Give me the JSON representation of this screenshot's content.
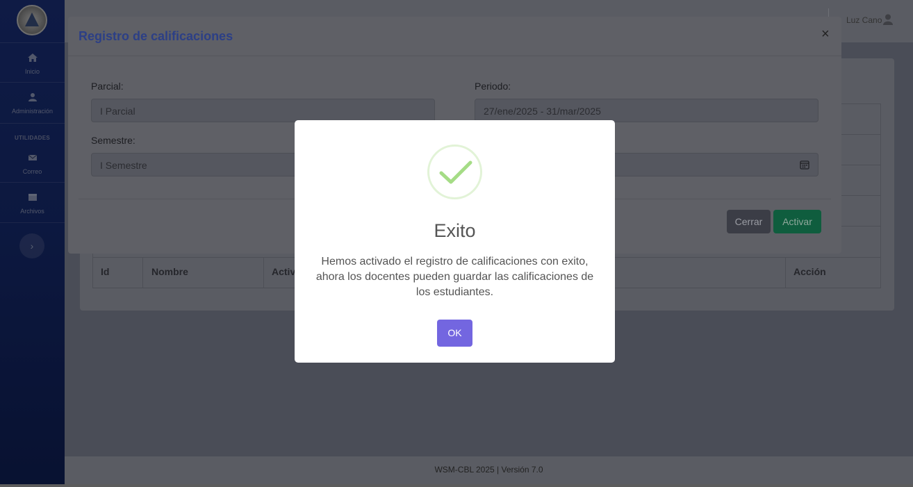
{
  "sidebar": {
    "items": [
      {
        "label": "Inicio",
        "icon": "home-icon"
      },
      {
        "label": "Administración",
        "icon": "users-icon"
      },
      {
        "label": "Correo",
        "icon": "mail-icon"
      },
      {
        "label": "Archivos",
        "icon": "folder-icon"
      }
    ],
    "section_label": "UTILIDADES",
    "toggle_icon": "chevron-right-icon"
  },
  "topbar": {
    "user_name": "Luz Cano",
    "user_icon": "user-icon"
  },
  "table": {
    "columns": [
      "Id",
      "Nombre",
      "Activ",
      "Acción"
    ]
  },
  "modal": {
    "title": "Registro de calificaciones",
    "close_label": "×",
    "fields": {
      "parcial": {
        "label": "Parcial:",
        "value": "I Parcial"
      },
      "periodo": {
        "label": "Periodo:",
        "value": "27/ene/2025 - 31/mar/2025"
      },
      "semestre": {
        "label": "Semestre:",
        "value": "I Semestre"
      },
      "fecha": {
        "value": "",
        "icon": "calendar-icon"
      }
    },
    "buttons": {
      "cerrar": "Cerrar",
      "activar": "Activar"
    }
  },
  "dialog": {
    "icon": "success-check-icon",
    "title": "Exito",
    "message": "Hemos activado el registro de calificaciones con exito, ahora los docentes pueden guardar las calificaciones de los estudiantes.",
    "ok_label": "OK"
  },
  "footer": {
    "text": "WSM-CBL 2025 | Versión 7.0"
  },
  "colors": {
    "sidebar": "#1a2f78",
    "ok_button": "#7366e0",
    "success_check": "#a5dc86",
    "modal_title": "#2c3f86"
  }
}
